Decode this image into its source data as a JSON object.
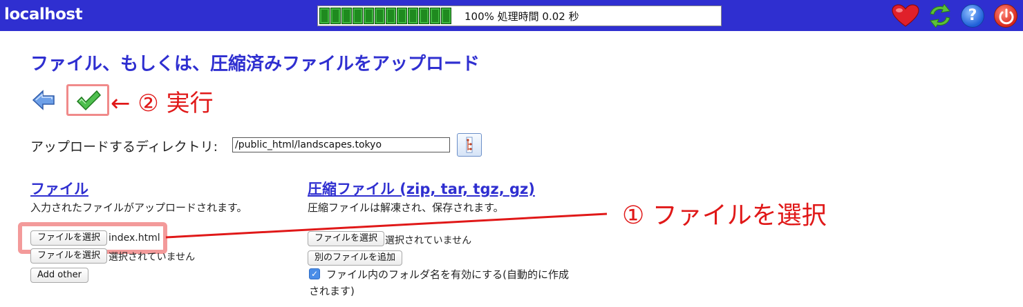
{
  "header": {
    "brand": "localhost",
    "progress_percent": 100,
    "progress_text": "100% 処理時間 0.02 秒",
    "icons": [
      "heart-icon",
      "refresh-icon",
      "help-icon",
      "power-icon"
    ],
    "help_glyph": "?"
  },
  "page": {
    "title": "ファイル、もしくは、圧縮済みファイルをアップロード",
    "annotation_execute": "← ② 実行",
    "annotation_select": "① ファイルを選択",
    "directory_label": "アップロードするディレクトリ:",
    "directory_value": "/public_html/landscapes.tokyo"
  },
  "files": {
    "title": "ファイル",
    "description": "入力されたファイルがアップロードされます。",
    "choose_label": "ファイルを選択",
    "file1_name": "index.html",
    "file2_name": "選択されていません",
    "add_other": "Add other"
  },
  "archive": {
    "title": "圧縮ファイル (zip, tar, tgz, gz)",
    "description": "圧縮ファイルは解凍され、保存されます。",
    "choose_label": "ファイルを選択",
    "file_name": "選択されていません",
    "add_file": "別のファイルを追加",
    "checkbox_label_line1": "ファイル内のフォルダ名を有効にする(自動的に作成",
    "checkbox_label_line2": "されます)",
    "checkbox_checked": true
  },
  "colors": {
    "brand_blue": "#2f2fd0",
    "annotation_red": "#e01818",
    "progress_green": "#1f8a1f"
  }
}
